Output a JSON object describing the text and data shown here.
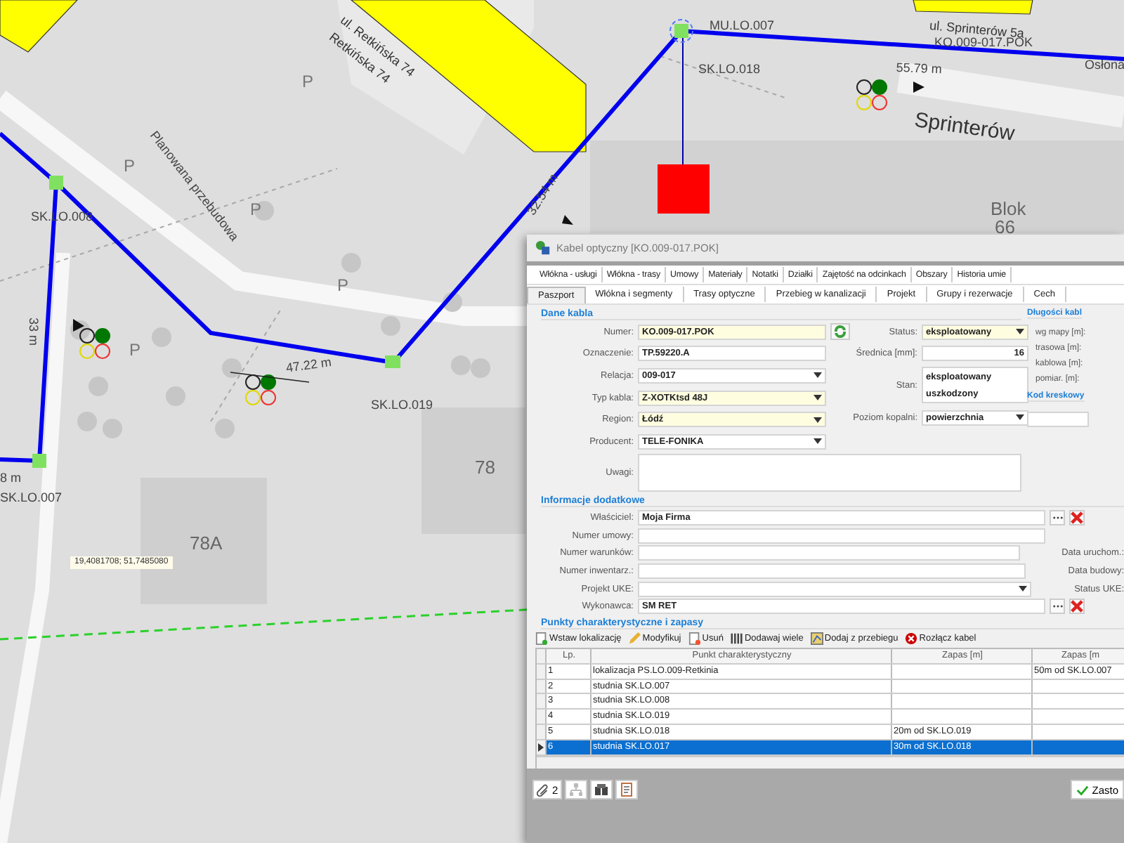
{
  "map": {
    "labels": [
      {
        "text": "ul. Retkińska 74",
        "kind": "street"
      },
      {
        "text": "Retkińska 74",
        "kind": "street"
      },
      {
        "text": "Planowana przebudowa",
        "kind": "note"
      },
      {
        "text": "SK.LO.008",
        "kind": "node"
      },
      {
        "text": "33 m",
        "kind": "length"
      },
      {
        "text": "8 m",
        "kind": "length"
      },
      {
        "text": "SK.LO.007",
        "kind": "node"
      },
      {
        "text": "47.22 m",
        "kind": "length"
      },
      {
        "text": "SK.LO.019",
        "kind": "node"
      },
      {
        "text": "32.54 m",
        "kind": "length"
      },
      {
        "text": "MU.LO.007",
        "kind": "node"
      },
      {
        "text": "SK.LO.018",
        "kind": "node"
      },
      {
        "text": "55.79 m",
        "kind": "length"
      },
      {
        "text": "ul. Sprinterów 5a",
        "kind": "street"
      },
      {
        "text": "KO.009-017.POK",
        "kind": "node"
      },
      {
        "text": "Sprinterów",
        "kind": "road"
      },
      {
        "text": "Blok",
        "kind": "building"
      },
      {
        "text": "66",
        "kind": "building"
      },
      {
        "text": "78",
        "kind": "building"
      },
      {
        "text": "78A",
        "kind": "building"
      },
      {
        "text": "Osłona",
        "kind": "node"
      },
      {
        "text": "P",
        "kind": "parking"
      },
      {
        "text": "P",
        "kind": "parking"
      },
      {
        "text": "P",
        "kind": "parking"
      },
      {
        "text": "P",
        "kind": "parking"
      },
      {
        "text": "P",
        "kind": "parking"
      }
    ],
    "coordinates": "19,4081708; 51,7485080"
  },
  "dialog": {
    "title": "Kabel optyczny [KO.009-017.POK]",
    "tabs_row_1": [
      {
        "label": "Włókna - usługi",
        "selected": false
      },
      {
        "label": "Włókna - trasy",
        "selected": false
      },
      {
        "label": "Umowy",
        "selected": false
      },
      {
        "label": "Materiały",
        "selected": false
      },
      {
        "label": "Notatki",
        "selected": false
      },
      {
        "label": "Działki",
        "selected": false
      },
      {
        "label": "Zajętość na odcinkach",
        "selected": false
      },
      {
        "label": "Obszary",
        "selected": false
      },
      {
        "label": "Historia umie",
        "selected": false
      }
    ],
    "tabs_row_2": [
      {
        "label": "Paszport",
        "selected": true
      },
      {
        "label": "Włókna i segmenty",
        "selected": false
      },
      {
        "label": "Trasy optyczne",
        "selected": false
      },
      {
        "label": "Przebieg w kanalizacji",
        "selected": false
      },
      {
        "label": "Projekt",
        "selected": false
      },
      {
        "label": "Grupy i rezerwacje",
        "selected": false
      },
      {
        "label": "Cech",
        "selected": false
      }
    ],
    "cable": {
      "title": "Dane kabla",
      "left_fields": [
        {
          "label": "Numer:",
          "value": "KO.009-017.POK",
          "kind": "refresh",
          "required": true
        },
        {
          "label": "Oznaczenie:",
          "value": "TP.59220.A",
          "kind": "text",
          "required": false
        },
        {
          "label": "Relacja:",
          "value": "009-017",
          "kind": "select",
          "required": false
        },
        {
          "label": "Typ kabla:",
          "value": "Z-XOTKtsd 48J",
          "kind": "select",
          "required": true
        },
        {
          "label": "Region:",
          "value": "Łódź",
          "kind": "select",
          "required": true
        },
        {
          "label": "Producent:",
          "value": "TELE-FONIKA",
          "kind": "select",
          "required": false
        }
      ],
      "right_fields": [
        {
          "label": "Status:",
          "values": [
            "eksploatowany"
          ],
          "kind": "select",
          "required": true
        },
        {
          "label": "Średnica [mm]:",
          "values": [
            "16"
          ],
          "kind": "number",
          "required": false
        },
        {
          "label": "Stan:",
          "values": [
            "eksploatowany",
            "uszkodzony"
          ],
          "kind": "list",
          "required": false
        },
        {
          "label": "Poziom kopalni:",
          "values": [
            "powierzchnia"
          ],
          "kind": "select",
          "required": false
        }
      ],
      "notes_label": "Uwagi:",
      "lengths_title": "Długości kabl",
      "lengths": [
        "wg mapy [m]:",
        "trasowa [m]:",
        "kablowa [m]:",
        "pomiar. [m]:"
      ],
      "barcode_title": "Kod kreskowy"
    },
    "extra": {
      "title": "Informacje dodatkowe",
      "fields": [
        {
          "label": "Właściciel:",
          "value": "Moja Firma",
          "kind": "picker"
        },
        {
          "label": "Numer umowy:",
          "kind": "text"
        },
        {
          "label": "Numer warunków:",
          "kind": "text",
          "side_label": "Data uruchom.:"
        },
        {
          "label": "Numer inwentarz.:",
          "kind": "text",
          "side_label": "Data budowy:"
        },
        {
          "label": "Projekt UKE:",
          "kind": "select",
          "side_label": "Status UKE:"
        },
        {
          "label": "Wykonawca:",
          "value": "SM RET",
          "kind": "picker"
        }
      ]
    },
    "points": {
      "title": "Punkty charakterystyczne i zapasy",
      "toolbar": [
        {
          "label": "Wstaw lokalizację",
          "kind": "insert"
        },
        {
          "label": "Modyfikuj",
          "kind": "edit"
        },
        {
          "label": "Usuń",
          "kind": "delete"
        },
        {
          "label": "Dodawaj wiele",
          "kind": "multi"
        },
        {
          "label": "Dodaj z przebiegu",
          "kind": "route"
        },
        {
          "label": "Rozłącz kabel",
          "kind": "disconnect"
        }
      ],
      "columns": [
        "Lp.",
        "Punkt charakterystyczny",
        "Zapas [m]",
        "Zapas [m"
      ],
      "rows": [
        {
          "cells": [
            "1",
            "lokalizacja PS.LO.009-Retkinia",
            "",
            "50m od SK.LO.007"
          ],
          "selected": false
        },
        {
          "cells": [
            "2",
            "studnia SK.LO.007",
            "",
            ""
          ],
          "selected": false
        },
        {
          "cells": [
            "3",
            "studnia SK.LO.008",
            "",
            ""
          ],
          "selected": false
        },
        {
          "cells": [
            "4",
            "studnia SK.LO.019",
            "",
            ""
          ],
          "selected": false
        },
        {
          "cells": [
            "5",
            "studnia SK.LO.018",
            "20m od SK.LO.019",
            ""
          ],
          "selected": false
        },
        {
          "cells": [
            "6",
            "studnia SK.LO.017",
            "30m od SK.LO.018",
            ""
          ],
          "selected": true
        }
      ]
    },
    "footer": {
      "attachments": "2",
      "apply": "Zasto"
    }
  }
}
